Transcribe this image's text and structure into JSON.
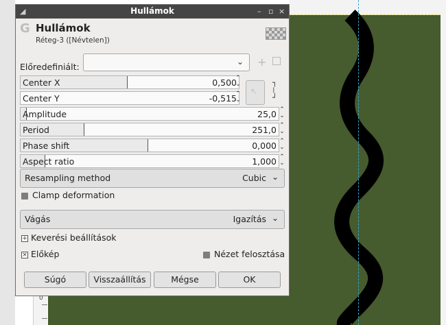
{
  "dialog": {
    "window_title": "Hullámok",
    "header_title": "Hullámok",
    "header_subtitle": "Réteg-3 ([Névtelen])",
    "titlebar_buttons": [
      "–",
      "▫",
      "×"
    ],
    "presets": {
      "label": "Előredefiniált:",
      "selected": ""
    },
    "sliders": [
      {
        "label": "Center X",
        "value": "0,500",
        "fill": 0.5
      },
      {
        "label": "Center Y",
        "value": "-0,515",
        "fill": 0.0
      },
      {
        "label": "Amplitude",
        "value": "25,0",
        "fill": 0.02
      },
      {
        "label": "Period",
        "value": "251,0",
        "fill": 0.25
      },
      {
        "label": "Phase shift",
        "value": "0,000",
        "fill": 0.5
      },
      {
        "label": "Aspect ratio",
        "value": "1,000",
        "fill": 0.1
      }
    ],
    "resampling": {
      "label": "Resampling method",
      "value": "Cubic"
    },
    "clamp_label": "Clamp deformation",
    "clipping": {
      "label": "Vágás",
      "value": "Igazítás"
    },
    "blending_label": "Keverési beállítások",
    "preview_label": "Előkép",
    "split_view_label": "Nézet felosztása",
    "buttons": {
      "help": "Súgó",
      "reset": "Visszaállítás",
      "cancel": "Mégse",
      "ok": "OK"
    }
  },
  "ruler": {
    "label": "0"
  },
  "colors": {
    "canvas": "#465b2e",
    "wave": "#000000",
    "titlebar": "#454545"
  }
}
